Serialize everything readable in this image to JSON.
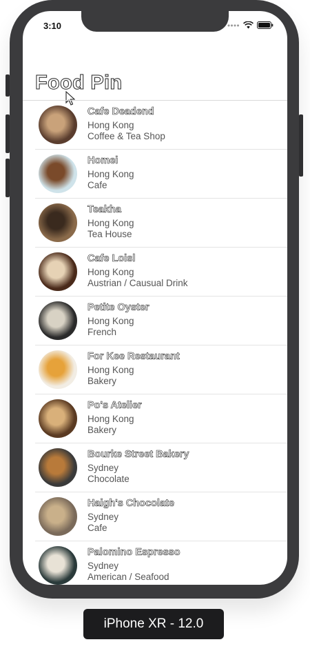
{
  "status_bar": {
    "time": "3:10",
    "icons": [
      "signal-dots-icon",
      "wifi-icon",
      "battery-icon"
    ]
  },
  "nav": {
    "title": "Food Pin"
  },
  "restaurants": [
    {
      "name": "Cafe Deadend",
      "location": "Hong Kong",
      "type": "Coffee & Tea Shop",
      "thumb_color": "#5a3d2e",
      "thumb_accent": "#c9a27a"
    },
    {
      "name": "Homei",
      "location": "Hong Kong",
      "type": "Cafe",
      "thumb_color": "#cfe3ea",
      "thumb_accent": "#7a4a2a"
    },
    {
      "name": "Teakha",
      "location": "Hong Kong",
      "type": "Tea House",
      "thumb_color": "#8a6a4a",
      "thumb_accent": "#3a2a1e"
    },
    {
      "name": "Cafe Loisl",
      "location": "Hong Kong",
      "type": "Austrian / Causual Drink",
      "thumb_color": "#4a2a1a",
      "thumb_accent": "#e6d2b5"
    },
    {
      "name": "Petite Oyster",
      "location": "Hong Kong",
      "type": "French",
      "thumb_color": "#2a2a2a",
      "thumb_accent": "#d8d2c4"
    },
    {
      "name": "For Kee Restaurant",
      "location": "Hong Kong",
      "type": "Bakery",
      "thumb_color": "#f2ede4",
      "thumb_accent": "#e6a23a"
    },
    {
      "name": "Po's Atelier",
      "location": "Hong Kong",
      "type": "Bakery",
      "thumb_color": "#5a3a22",
      "thumb_accent": "#d9b07a"
    },
    {
      "name": "Bourke Street Bakery",
      "location": "Sydney",
      "type": "Chocolate",
      "thumb_color": "#3a3a3a",
      "thumb_accent": "#b87a3a"
    },
    {
      "name": "Haigh's Chocolate",
      "location": "Sydney",
      "type": "Cafe",
      "thumb_color": "#7a6a5a",
      "thumb_accent": "#c9b08a"
    },
    {
      "name": "Palomino Espresso",
      "location": "Sydney",
      "type": "American / Seafood",
      "thumb_color": "#2a3a3a",
      "thumb_accent": "#e8e2d6"
    }
  ],
  "device_label": "iPhone XR - 12.0",
  "colors": {
    "frame": "#3b3b3d",
    "separator": "#e3e3e3",
    "label_bg": "#1c1c1e"
  }
}
